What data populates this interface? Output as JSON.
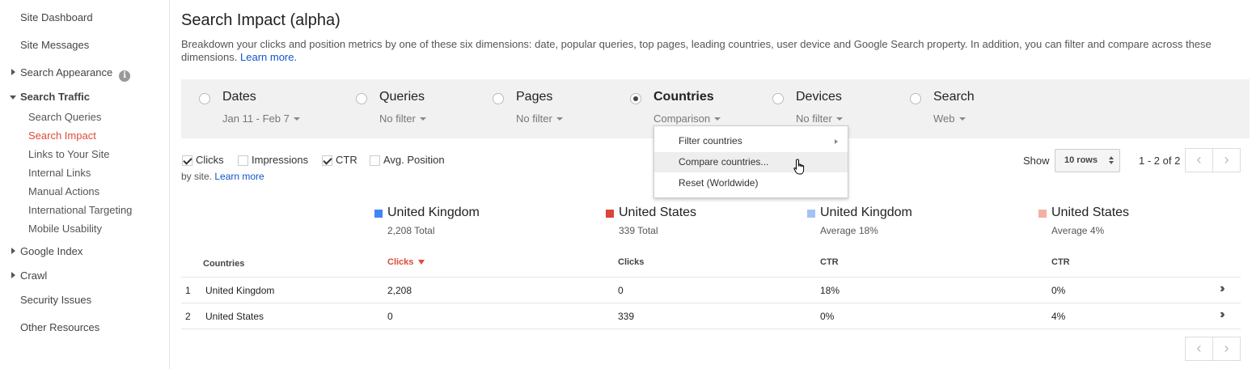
{
  "sidebar": {
    "site_dashboard": "Site Dashboard",
    "site_messages": "Site Messages",
    "search_appearance": "Search Appearance",
    "info_glyph": "i",
    "search_traffic": "Search Traffic",
    "search_traffic_items": [
      "Search Queries",
      "Search Impact",
      "Links to Your Site",
      "Internal Links",
      "Manual Actions",
      "International Targeting",
      "Mobile Usability"
    ],
    "google_index": "Google Index",
    "crawl": "Crawl",
    "security_issues": "Security Issues",
    "other_resources": "Other Resources"
  },
  "header": {
    "title": "Search Impact (alpha)",
    "description": "Breakdown your clicks and position metrics by one of these six dimensions: date, popular queries, top pages, leading countries, user device and Google Search property. In addition, you can filter and compare across these dimensions.",
    "learn_more": "Learn more."
  },
  "dimensions": [
    {
      "label": "Dates",
      "sub": "Jan 11 - Feb 7",
      "selected": false
    },
    {
      "label": "Queries",
      "sub": "No filter",
      "selected": false
    },
    {
      "label": "Pages",
      "sub": "No filter",
      "selected": false
    },
    {
      "label": "Countries",
      "sub": "Comparison",
      "selected": true
    },
    {
      "label": "Devices",
      "sub": "No filter",
      "selected": false
    },
    {
      "label": "Search",
      "sub": "Web",
      "selected": false
    }
  ],
  "dropdown": {
    "items": [
      "Filter countries",
      "Compare countries...",
      "Reset (Worldwide)"
    ]
  },
  "metrics": {
    "clicks": "Clicks",
    "impressions": "Impressions",
    "ctr": "CTR",
    "avg_position": "Avg. Position",
    "clicks_checked": true,
    "impressions_checked": false,
    "ctr_checked": true,
    "avg_position_checked": false,
    "by_site": "by site.",
    "learn_more": "Learn more"
  },
  "pager": {
    "show_label": "Show",
    "rows_value": "10 rows",
    "range": "1 - 2 of 2",
    "prev": "‹",
    "next": "›"
  },
  "series": [
    {
      "name": "United Kingdom",
      "value": "2,208 Total",
      "color": "#4285f4"
    },
    {
      "name": "United States",
      "value": "339 Total",
      "color": "#db4437"
    },
    {
      "name": "United Kingdom",
      "value": "Average 18%",
      "color": "#a4c2f4"
    },
    {
      "name": "United States",
      "value": "Average 4%",
      "color": "#f4b0a0"
    }
  ],
  "table": {
    "headers": [
      "Countries",
      "Clicks",
      "Clicks",
      "CTR",
      "CTR"
    ],
    "rows": [
      {
        "num": "1",
        "country": "United Kingdom",
        "c1": "2,208",
        "c2": "0",
        "c3": "18%",
        "c4": "0%"
      },
      {
        "num": "2",
        "country": "United States",
        "c1": "0",
        "c2": "339",
        "c3": "0%",
        "c4": "4%"
      }
    ],
    "expand_glyph": "››"
  },
  "colors": {
    "accent_red": "#dd4b39",
    "link_blue": "#1155cc",
    "filter_bar_bg": "#f1f1f1"
  }
}
